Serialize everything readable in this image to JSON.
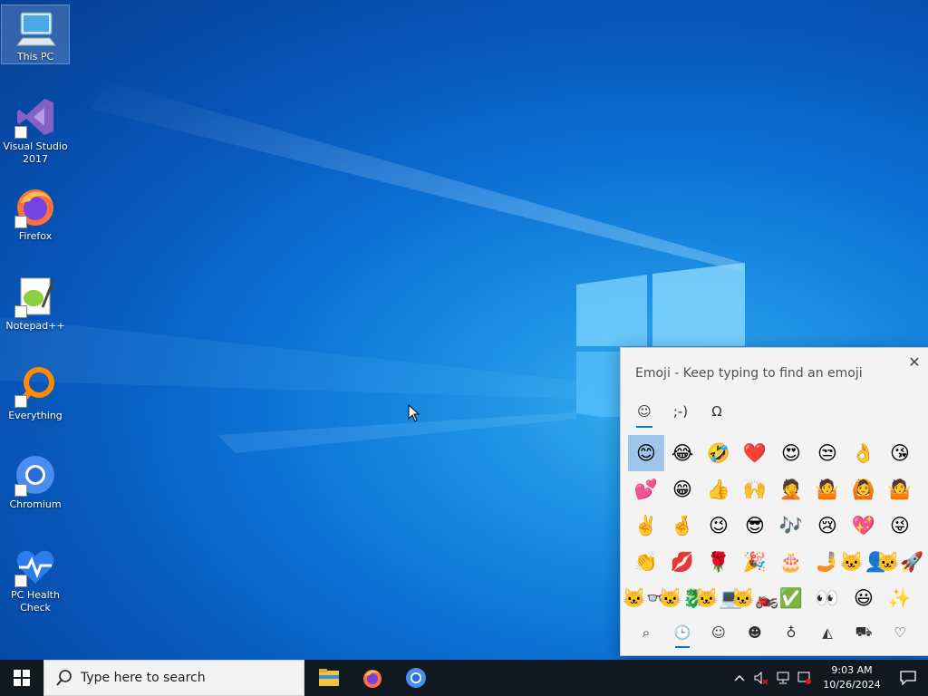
{
  "desktop": {
    "icons": [
      {
        "label": "This PC"
      },
      {
        "label": "Visual Studio 2017"
      },
      {
        "label": "Firefox"
      },
      {
        "label": "Notepad++"
      },
      {
        "label": "Everything"
      },
      {
        "label": "Chromium"
      },
      {
        "label": "PC Health Check"
      }
    ]
  },
  "emoji_panel": {
    "title": "Emoji - Keep typing to find an emoji",
    "close_glyph": "✕",
    "tabs": [
      {
        "name": "emoji",
        "glyph": "☺",
        "active": true
      },
      {
        "name": "kaomoji",
        "glyph": ";-)",
        "active": false
      },
      {
        "name": "symbols",
        "glyph": "Ω",
        "active": false
      }
    ],
    "grid": [
      "😊",
      "😂",
      "🤣",
      "❤️",
      "😍",
      "😒",
      "👌",
      "😘",
      "💕",
      "😁",
      "👍",
      "🙌",
      "🤦",
      "🤷",
      "🙆",
      "🤷",
      "✌️",
      "🤞",
      "😉",
      "😎",
      "🎶",
      "😢",
      "💖",
      "😜",
      "👏",
      "💋",
      "🌹",
      "🎉",
      "🎂",
      "🤳",
      "🐱‍👤",
      "🐱‍🚀",
      "🐱‍👓",
      "🐱‍🐉",
      "🐱‍💻",
      "🐱‍🏍",
      "✅",
      "👀",
      "😃",
      "✨"
    ],
    "selected_index": 0,
    "categories": [
      {
        "name": "search",
        "glyph": "⌕"
      },
      {
        "name": "recent",
        "glyph": "🕒",
        "active": true
      },
      {
        "name": "smileys",
        "glyph": "☺"
      },
      {
        "name": "people",
        "glyph": "☻"
      },
      {
        "name": "celebrations",
        "glyph": "♁"
      },
      {
        "name": "food",
        "glyph": "◭"
      },
      {
        "name": "travel",
        "glyph": "⛟"
      },
      {
        "name": "symbols",
        "glyph": "♡"
      }
    ]
  },
  "taskbar": {
    "search_placeholder": "Type here to search",
    "clock_time": "9:03 AM",
    "clock_date": "10/26/2024",
    "apps": [
      "file-explorer",
      "firefox",
      "chromium"
    ],
    "tray": [
      "show-hidden-icons",
      "volume-muted",
      "network",
      "security"
    ]
  },
  "colors": {
    "accent": "#0078d4",
    "taskbar": "#101820",
    "panel_bg": "#f3f3f3"
  }
}
